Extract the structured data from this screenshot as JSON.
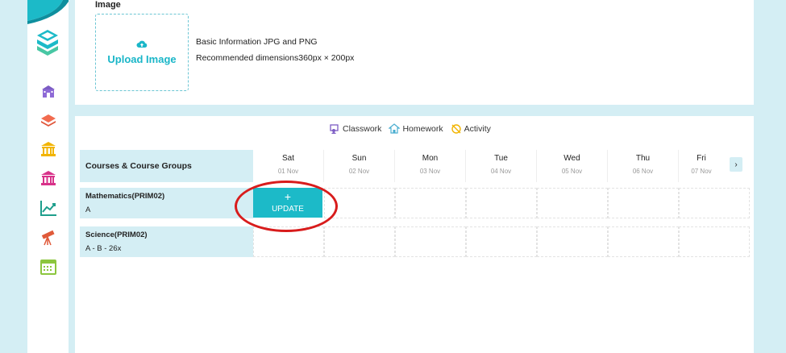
{
  "image_section": {
    "label": "Image",
    "upload_label": "Upload Image",
    "info_formats": "Basic Information JPG and PNG",
    "info_dimensions": "Recommended dimensions360px × 200px"
  },
  "legend": {
    "classwork": "Classwork",
    "homework": "Homework",
    "activity": "Activity"
  },
  "schedule": {
    "header_label": "Courses & Course Groups",
    "days": [
      {
        "name": "Sat",
        "date": "01 Nov"
      },
      {
        "name": "Sun",
        "date": "02 Nov"
      },
      {
        "name": "Mon",
        "date": "03 Nov"
      },
      {
        "name": "Tue",
        "date": "04 Nov"
      },
      {
        "name": "Wed",
        "date": "05 Nov"
      },
      {
        "name": "Thu",
        "date": "06 Nov"
      },
      {
        "name": "Fri",
        "date": "07 Nov"
      }
    ],
    "next_symbol": "›",
    "rows": [
      {
        "course": "Mathematics(PRIM02)",
        "group": "A"
      },
      {
        "course": "Science(PRIM02)",
        "group": "A - B - 26x"
      }
    ],
    "update_plus": "+",
    "update_label": "UPDATE"
  },
  "colors": {
    "accent": "#1cbac8",
    "light_bg": "#d4eef4",
    "highlight": "#d81c1c"
  },
  "icons": [
    "school-icon",
    "layers-icon",
    "institution-icon",
    "building-icon",
    "chart-line-icon",
    "telescope-icon",
    "calendar-icon"
  ]
}
